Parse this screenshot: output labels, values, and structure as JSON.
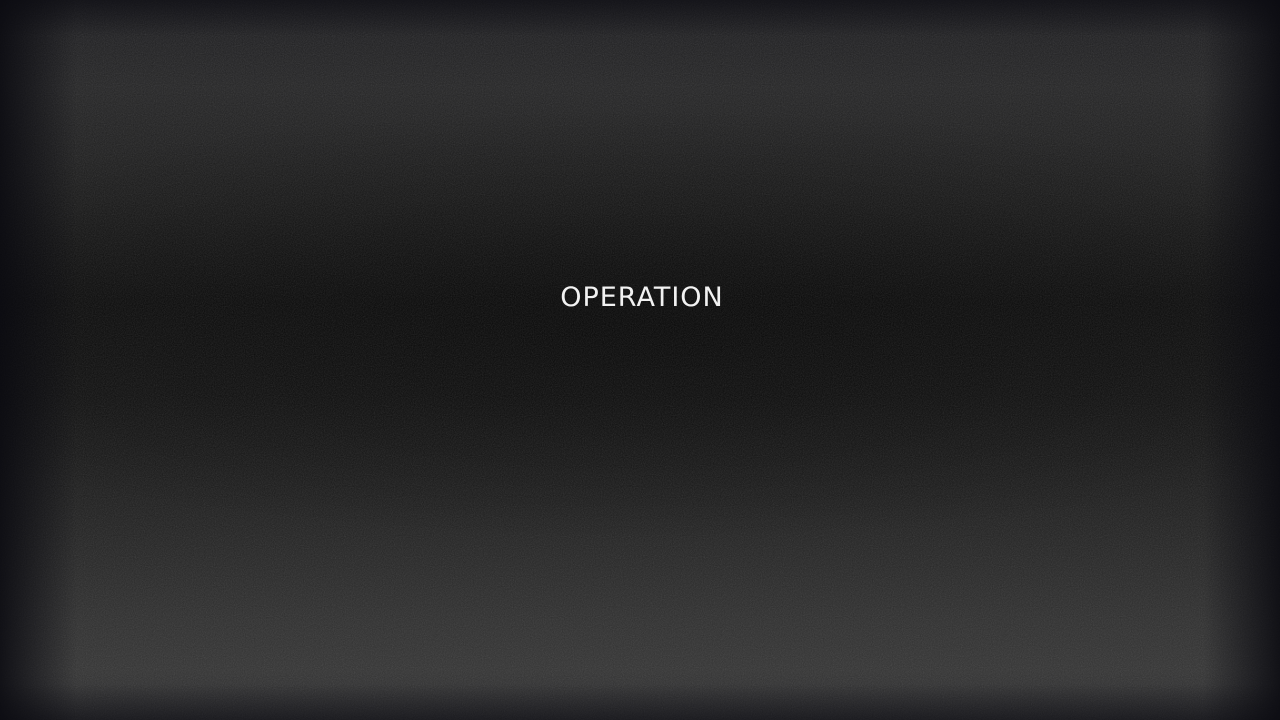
{
  "screen": {
    "title": "OPERATION"
  }
}
